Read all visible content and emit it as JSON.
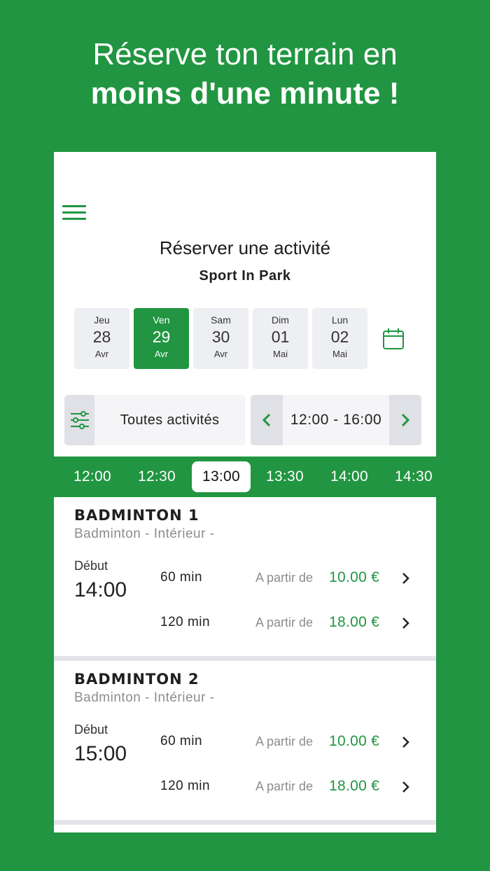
{
  "headline": {
    "line1": "Réserve ton terrain en",
    "line2": "moins d'une minute !"
  },
  "app": {
    "title": "Réserver une activité",
    "venue": "Sport In Park",
    "days": [
      {
        "name": "Jeu",
        "date": "28",
        "month": "Avr"
      },
      {
        "name": "Ven",
        "date": "29",
        "month": "Avr",
        "selected": true
      },
      {
        "name": "Sam",
        "date": "30",
        "month": "Avr"
      },
      {
        "name": "Dim",
        "date": "01",
        "month": "Mai"
      },
      {
        "name": "Lun",
        "date": "02",
        "month": "Mai"
      }
    ],
    "filter_label": "Toutes activités",
    "time_range": "12:00 - 16:00",
    "slots": [
      "12:00",
      "12:30",
      "13:00",
      "13:30",
      "14:00",
      "14:30"
    ],
    "active_slot": "13:00",
    "courts": [
      {
        "name": "BADMINTON 1",
        "type": "Badminton - Intérieur  -",
        "start_label": "Début",
        "start_time": "14:00",
        "options": [
          {
            "duration": "60 min",
            "from": "A partir de",
            "price": "10.00 €"
          },
          {
            "duration": "120 min",
            "from": "A partir de",
            "price": "18.00 €"
          }
        ]
      },
      {
        "name": "BADMINTON 2",
        "type": "Badminton - Intérieur  -",
        "start_label": "Début",
        "start_time": "15:00",
        "options": [
          {
            "duration": "60 min",
            "from": "A partir de",
            "price": "10.00 €"
          },
          {
            "duration": "120 min",
            "from": "A partir de",
            "price": "18.00 €"
          }
        ]
      }
    ]
  },
  "colors": {
    "brand_green": "#219541",
    "tile_bg": "#eeeff2",
    "muted_text": "#8d8d8d"
  },
  "icons": {
    "menu": "hamburger-icon",
    "calendar": "calendar-icon",
    "filter": "sliders-icon",
    "prev": "chevron-left-icon",
    "next": "chevron-right-icon"
  }
}
